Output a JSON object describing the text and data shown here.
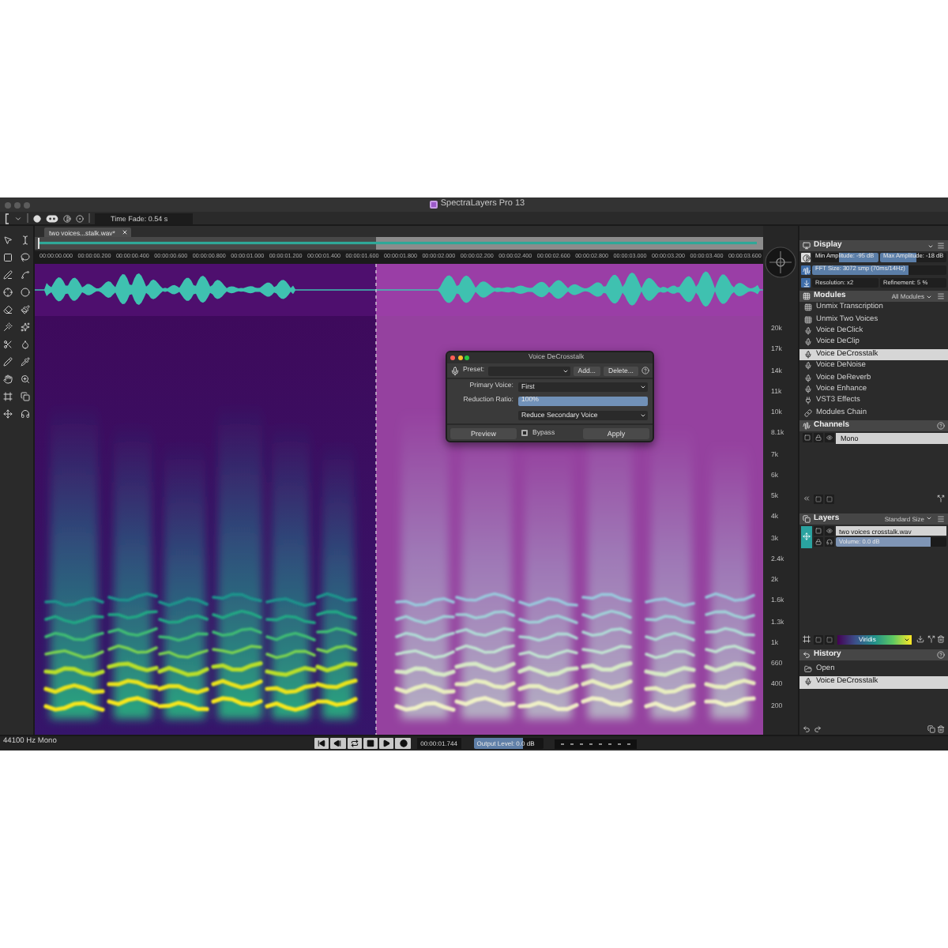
{
  "window": {
    "title": "SpectraLayers Pro 13"
  },
  "toolbar": {
    "time_fade": "Time Fade: 0.54 s"
  },
  "tabs": [
    {
      "label": "two voices...stalk.wav*",
      "selected": true
    }
  ],
  "ruler": {
    "ticks": [
      "00:00:00.000",
      "00:00:00.200",
      "00:00:00.400",
      "00:00:00.600",
      "00:00:00.800",
      "00:00:01.000",
      "00:00:01.200",
      "00:00:01.400",
      "00:00:01.600",
      "00:00:01.800",
      "00:00:02.000",
      "00:00:02.200",
      "00:00:02.400",
      "00:00:02.600",
      "00:00:02.800",
      "00:00:03.000",
      "00:00:03.200",
      "00:00:03.400",
      "00:00:03.600"
    ]
  },
  "frequency_axis": {
    "labels": [
      "20k",
      "17k",
      "14k",
      "11k",
      "10k",
      "8.1k",
      "7k",
      "6k",
      "5k",
      "4k",
      "3k",
      "2.4k",
      "2k",
      "1.6k",
      "1.3k",
      "1k",
      "660",
      "400",
      "200"
    ]
  },
  "dialog": {
    "title": "Voice DeCrosstalk",
    "preset_label": "Preset:",
    "top_buttons": [
      "Add...",
      "Delete..."
    ],
    "fields": [
      {
        "kind": "select",
        "label": "Primary Voice:",
        "value": "First"
      },
      {
        "kind": "slider",
        "label": "Reduction Ratio:",
        "value": "100%",
        "level": 1
      },
      {
        "kind": "select",
        "value": "Reduce Secondary Voice"
      }
    ],
    "preview": "Preview",
    "bypass": {
      "label": "Bypass",
      "checked": false
    },
    "apply": "Apply"
  },
  "display_panel": {
    "title": "Display",
    "rows": [
      {
        "fields": [
          {
            "kind": "inverse",
            "text": "Min Amplitude: -95 dB",
            "level": 0.6
          },
          {
            "kind": "slider",
            "text": "Max Amplitude: -18 dB",
            "level": 0.55
          }
        ]
      },
      {
        "fields": [
          {
            "kind": "slider",
            "text": "FFT Size: 3072 smp (70ms/14Hz)",
            "level": 0.72
          }
        ]
      },
      {
        "fields": [
          {
            "kind": "field",
            "text": "Resolution: x2"
          },
          {
            "kind": "field",
            "text": "Refinement: 5 %"
          }
        ]
      }
    ]
  },
  "modules_panel": {
    "title": "Modules",
    "filter": "All Modules",
    "items": [
      {
        "label": "Unmix Transcription",
        "selected": false
      },
      {
        "label": "Unmix Two Voices",
        "selected": false
      },
      {
        "label": "Voice DeClick",
        "selected": false
      },
      {
        "label": "Voice DeClip",
        "selected": false
      },
      {
        "label": "Voice DeCrosstalk",
        "selected": true
      },
      {
        "label": "Voice DeNoise",
        "selected": false
      },
      {
        "label": "Voice DeReverb",
        "selected": false
      },
      {
        "label": "Voice Enhance",
        "selected": false
      },
      {
        "label": "VST3 Effects",
        "selected": false
      },
      {
        "label": "Modules Chain",
        "selected": false
      }
    ]
  },
  "channels_panel": {
    "title": "Channels",
    "items": [
      {
        "label": "Mono",
        "selected": true
      }
    ]
  },
  "layers_panel": {
    "title": "Layers",
    "size_menu": "Standard Size",
    "layers": [
      {
        "name": "two voices crosstalk.wav",
        "selected": true,
        "volume": {
          "text": "Volume: 0.0 dB",
          "level": 0.85
        }
      }
    ],
    "colormap": "Viridis"
  },
  "history_panel": {
    "title": "History",
    "items": [
      {
        "label": "Open",
        "selected": false
      },
      {
        "label": "Voice DeCrosstalk",
        "selected": true
      }
    ]
  },
  "status_bar": {
    "format": "44100 Hz Mono",
    "time": "00:00:01.744",
    "output_level": {
      "text": "Output Level: 0.0 dB",
      "level": 0.7
    }
  }
}
